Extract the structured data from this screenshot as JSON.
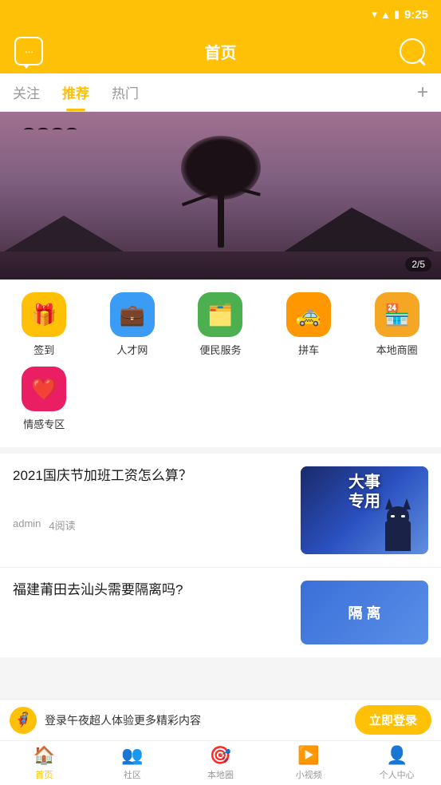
{
  "statusBar": {
    "time": "9:25",
    "icons": [
      "wifi",
      "signal",
      "battery"
    ]
  },
  "header": {
    "title": "首页",
    "chatLabel": "消息",
    "searchLabel": "搜索"
  },
  "tabs": [
    {
      "id": "follow",
      "label": "关注",
      "active": false
    },
    {
      "id": "recommend",
      "label": "推荐",
      "active": true
    },
    {
      "id": "hot",
      "label": "热门",
      "active": false
    }
  ],
  "tabs_add": "+",
  "banner": {
    "counter": "2/5",
    "altText": "风景图"
  },
  "gridIcons": [
    {
      "id": "checkin",
      "label": "签到",
      "icon": "🎁",
      "color": "ic-yellow"
    },
    {
      "id": "talent",
      "label": "人才网",
      "icon": "💼",
      "color": "ic-blue"
    },
    {
      "id": "service",
      "label": "便民服务",
      "icon": "🗂️",
      "color": "ic-green"
    },
    {
      "id": "carpool",
      "label": "拼车",
      "icon": "🚕",
      "color": "ic-orange"
    },
    {
      "id": "store",
      "label": "本地商圈",
      "icon": "🏪",
      "color": "ic-red-store"
    },
    {
      "id": "emotion",
      "label": "情感专区",
      "icon": "❤️",
      "color": "ic-pink"
    }
  ],
  "articles": [
    {
      "id": "article1",
      "title": "2021国庆节加班工资怎么算？",
      "author": "admin",
      "reads": "4阅读",
      "thumbType": "batman",
      "thumbBigText": "大事\n专用"
    },
    {
      "id": "article2",
      "title": "福建莆田去汕头需要隔离吗?",
      "author": "",
      "reads": "",
      "thumbType": "blue",
      "thumbText": "隔离"
    }
  ],
  "loginBanner": {
    "text": "登录午夜超人体验更多精彩内容",
    "buttonLabel": "立即登录",
    "avatarEmoji": "🦸"
  },
  "bottomNav": [
    {
      "id": "home",
      "label": "首页",
      "active": true,
      "icon": "🏠"
    },
    {
      "id": "community",
      "label": "社区",
      "active": false,
      "icon": "👥"
    },
    {
      "id": "local",
      "label": "本地圈",
      "active": false,
      "icon": "🎯"
    },
    {
      "id": "video",
      "label": "小视频",
      "active": false,
      "icon": "▶️"
    },
    {
      "id": "profile",
      "label": "个人中心",
      "active": false,
      "icon": "👤"
    }
  ]
}
